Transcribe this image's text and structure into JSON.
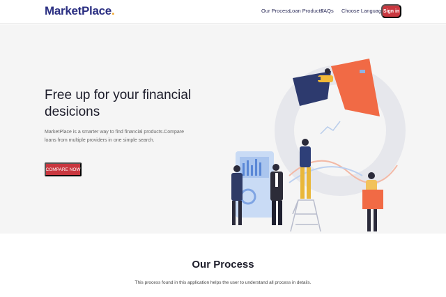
{
  "navbar": {
    "brand": "MarketPlace",
    "brand_dot": ".",
    "links": [
      "Our Process",
      "Loan Products",
      "FAQs"
    ],
    "language_label": "Choose Language",
    "signin_label": "Sign in"
  },
  "hero": {
    "title": "Free up for your financial desicions",
    "description": "MarketPlace is a smarter way to find financial products.Compare loans from multiple providers in one simple search.",
    "cta_label": "COMPARE NOW"
  },
  "process": {
    "title": "Our Process",
    "description": "This process found in this application helps the user to understand all process in details."
  },
  "colors": {
    "brand": "#2b2f82",
    "accent": "#c9373f",
    "brand_dot": "#f0a020",
    "hero_bg": "#f5f5f5"
  },
  "icons": [
    "caret-down-icon",
    "finance-people-illustration"
  ]
}
